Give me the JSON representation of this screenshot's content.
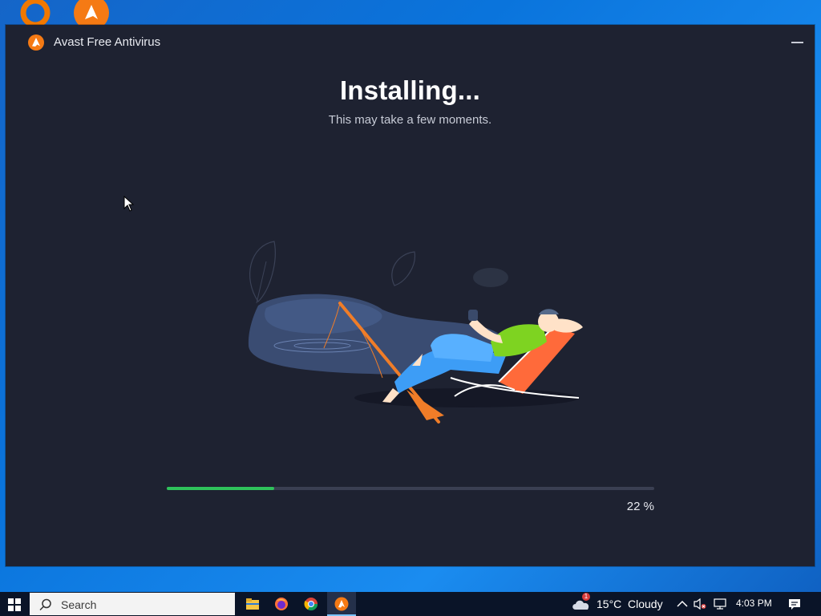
{
  "window": {
    "title": "Avast Free Antivirus",
    "heading": "Installing...",
    "subheading": "This may take a few moments."
  },
  "progress": {
    "value": 0.22,
    "label": "22 %"
  },
  "taskbar": {
    "search_label": "Search",
    "apps": [
      "file-explorer-icon",
      "firefox-icon",
      "chrome-icon",
      "avast-icon"
    ],
    "weather": {
      "temp": "15°C",
      "condition": "Cloudy",
      "badge": "1"
    },
    "time": "4:03 PM"
  },
  "colors": {
    "window_bg": "#1e2231",
    "accent_orange": "#ff7800",
    "progress_green": "#2fc25b",
    "taskbar_bg": "#0a1428"
  }
}
